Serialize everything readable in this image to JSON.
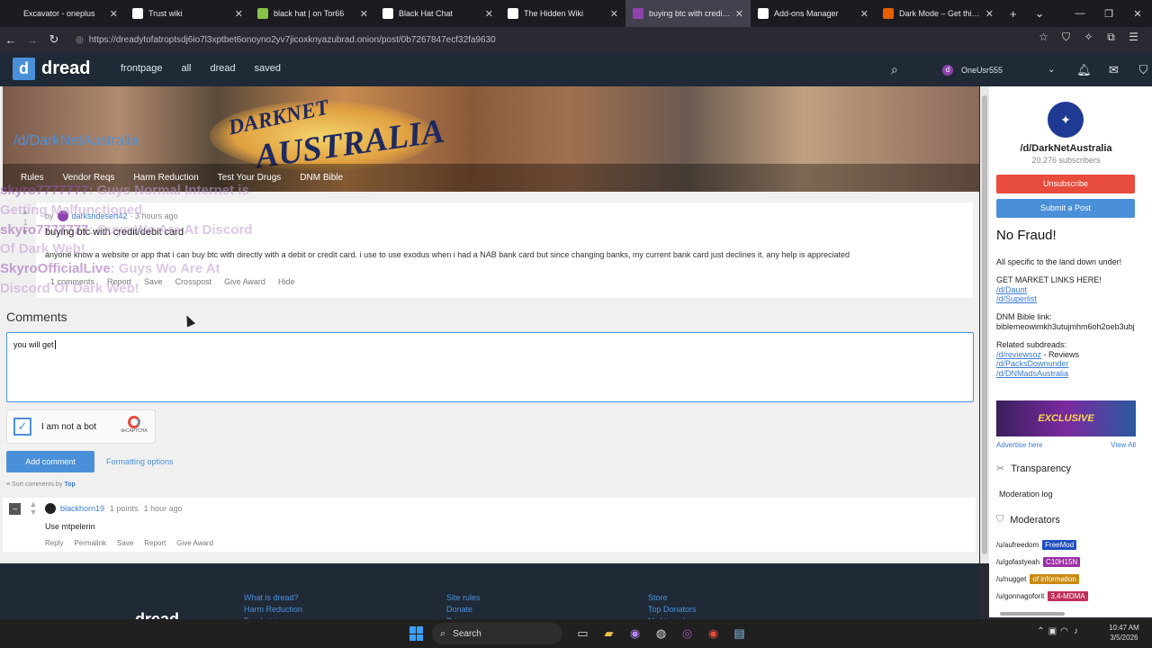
{
  "tabs": [
    {
      "title": "Excavator - oneplus",
      "icon": "page-icon",
      "color": "#1c1b22",
      "active": false
    },
    {
      "title": "Trust wiki",
      "icon": "wiki-icon",
      "color": "#ffffff",
      "active": false
    },
    {
      "title": "black hat | on Tor66",
      "icon": "tor66-icon",
      "color": "#8bc34a",
      "active": false
    },
    {
      "title": "Black Hat Chat",
      "icon": "chat-icon",
      "color": "#ffffff",
      "active": false
    },
    {
      "title": "The Hidden Wiki",
      "icon": "wiki-icon",
      "color": "#ffffff",
      "active": false
    },
    {
      "title": "buying btc with credit/debit",
      "icon": "dread-icon",
      "color": "#8e44ad",
      "active": true
    },
    {
      "title": "Add-ons Manager",
      "icon": "puzzle-icon",
      "color": "#ffffff",
      "active": false
    },
    {
      "title": "Dark Mode – Get this Extens",
      "icon": "firefox-icon",
      "color": "#e66000",
      "active": false
    }
  ],
  "url": "https://dreadytofatroptsdj6io7l3xptbet6onoyno2yv7jicoxknyazubrad.onion/post/0b7267847ecf32fa9630",
  "header": {
    "logo_letter": "d",
    "logo_text": "dread",
    "nav": [
      "frontpage",
      "all",
      "dread",
      "saved"
    ],
    "username": "OneUsr555"
  },
  "banner": {
    "title_top": "DARKNET",
    "title_main": "AUSTRALIA",
    "subdread": "/d/DarkNetAustralia",
    "links": [
      "Rules",
      "Vendor Reqs",
      "Harm Reduction",
      "Test Your Drugs",
      "DNM Bible"
    ]
  },
  "overlay": {
    "line1_user": "skyro7777777",
    "line1_text": ": Guys Normal Internet is",
    "line2": "Getting Malfunctioned",
    "line3_user": "skyro7777777",
    "line3_text": ": Guys Wo Are At Discord",
    "line4": "Of Dark Web!",
    "line5_user": "SkyroOfficialLive",
    "line5_text": ": Guys Wo Are At",
    "line6": "Discord Of Dark Web!"
  },
  "post": {
    "score": "1",
    "by": "by",
    "author": "darksndesert42",
    "time": "· 3 hours ago",
    "title": "buying btc with credit/debit card",
    "body": "anyone know a website or app that i can buy btc with directly with a debit or credit card. i use to use exodus when i had a NAB bank card but since changing banks, my current bank card just declines it. any help is appreciated",
    "actions": [
      "1 comments",
      "Report",
      "Save",
      "Crosspost",
      "Give Award",
      "Hide"
    ]
  },
  "comments": {
    "heading": "Comments",
    "draft": "you will get ",
    "captcha_label": "I am not a bot",
    "captcha_brand": "deCAPTCHA",
    "add_label": "Add comment",
    "format_label": "Formatting options",
    "sort_prefix": "Sort comments by",
    "sort_value": "Top",
    "items": [
      {
        "collapse": "–",
        "author": "blackhorn19",
        "points": "1 points",
        "time": "1 hour ago",
        "body": "Use mtpelerin",
        "actions": [
          "Reply",
          "Permalink",
          "Save",
          "Report",
          "Give Award"
        ]
      }
    ]
  },
  "sidebar": {
    "name": "/d/DarkNetAustralia",
    "subscribers": "20,276 subscribers",
    "unsubscribe": "Unsubscribe",
    "submit": "Submit a Post",
    "headline": "No Fraud!",
    "tagline": "All specific to the land down under!",
    "market_heading": "GET MARKET LINKS HERE!",
    "market_links": [
      "/d/Daunt",
      "/d/Superlist"
    ],
    "bible_label": "DNM Bible link:",
    "bible_value": "biblemeowimkh3utujmhm6oh2oeb3ubj",
    "related_label": "Related subdreads:",
    "related": [
      {
        "link": "/d/reviewsoz",
        "suffix": " - Reviews"
      },
      {
        "link": "/d/PacksDownunder",
        "suffix": ""
      },
      {
        "link": "/d/DNMadsAustralia",
        "suffix": ""
      }
    ],
    "ad_text": "EXCLUSIVE",
    "advertise": "Advertise here",
    "view_all": "View All",
    "transparency": "Transparency",
    "moderation_log": "Moderation log",
    "moderators_heading": "Moderators",
    "moderators": [
      {
        "name": "/u/aufreedom",
        "flair": "FreeMod",
        "color": "#1f4fbf"
      },
      {
        "name": "/u/gofastyeah",
        "flair": "C10H15N",
        "color": "#9b2fa5"
      },
      {
        "name": "/u/nugget",
        "flair": "of information",
        "color": "#c98a10"
      },
      {
        "name": "/u/gonnagoforit",
        "flair": "3,4-MDMA",
        "color": "#c0305a"
      }
    ]
  },
  "footer": {
    "logo": "dread",
    "col1": [
      "What is dread?",
      "Harm Reduction",
      "Fundraising"
    ],
    "col2": [
      "Site rules",
      "Donate",
      "Privacy"
    ],
    "col3": [
      "Store",
      "Top Donators",
      "Night mode"
    ]
  },
  "taskbar": {
    "search": "Search",
    "time": "10:47 AM",
    "date": "3/5/2026"
  }
}
